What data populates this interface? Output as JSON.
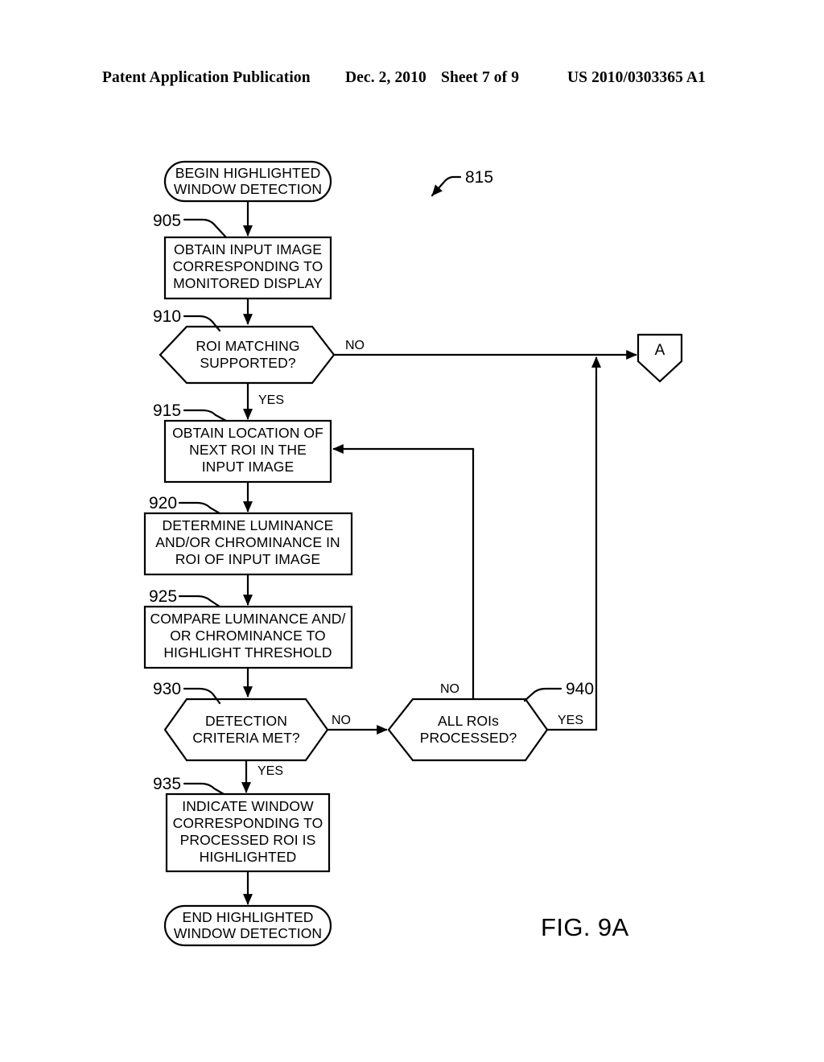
{
  "header": {
    "publication": "Patent Application Publication",
    "date": "Dec. 2, 2010",
    "sheet": "Sheet 7 of 9",
    "patent_number": "US 2010/0303365 A1"
  },
  "figure": {
    "label": "FIG. 9A",
    "diagram_ref": "815",
    "offpage_connector": "A"
  },
  "nodes": {
    "start": {
      "type": "terminator",
      "line1": "BEGIN HIGHLIGHTED",
      "line2": "WINDOW DETECTION"
    },
    "n905": {
      "ref": "905",
      "type": "process",
      "line1": "OBTAIN INPUT IMAGE",
      "line2": "CORRESPONDING TO",
      "line3": "MONITORED DISPLAY"
    },
    "n910": {
      "ref": "910",
      "type": "decision",
      "line1": "ROI MATCHING",
      "line2": "SUPPORTED?"
    },
    "n915": {
      "ref": "915",
      "type": "process",
      "line1": "OBTAIN LOCATION OF",
      "line2": "NEXT ROI IN THE",
      "line3": "INPUT IMAGE"
    },
    "n920": {
      "ref": "920",
      "type": "process",
      "line1": "DETERMINE LUMINANCE",
      "line2": "AND/OR CHROMINANCE IN",
      "line3": "ROI OF INPUT IMAGE"
    },
    "n925": {
      "ref": "925",
      "type": "process",
      "line1": "COMPARE LUMINANCE AND/",
      "line2": "OR CHROMINANCE TO",
      "line3": "HIGHLIGHT THRESHOLD"
    },
    "n930": {
      "ref": "930",
      "type": "decision",
      "line1": "DETECTION",
      "line2": "CRITERIA MET?"
    },
    "n935": {
      "ref": "935",
      "type": "process",
      "line1": "INDICATE WINDOW",
      "line2": "CORRESPONDING TO",
      "line3": "PROCESSED ROI IS",
      "line4": "HIGHLIGHTED"
    },
    "n940": {
      "ref": "940",
      "type": "decision",
      "line1": "ALL ROIs",
      "line2": "PROCESSED?"
    },
    "end": {
      "type": "terminator",
      "line1": "END HIGHLIGHTED",
      "line2": "WINDOW DETECTION"
    }
  },
  "edges": {
    "e910_no": "NO",
    "e910_yes": "YES",
    "e930_no": "NO",
    "e930_yes": "YES",
    "e940_no": "NO",
    "e940_yes": "YES"
  }
}
